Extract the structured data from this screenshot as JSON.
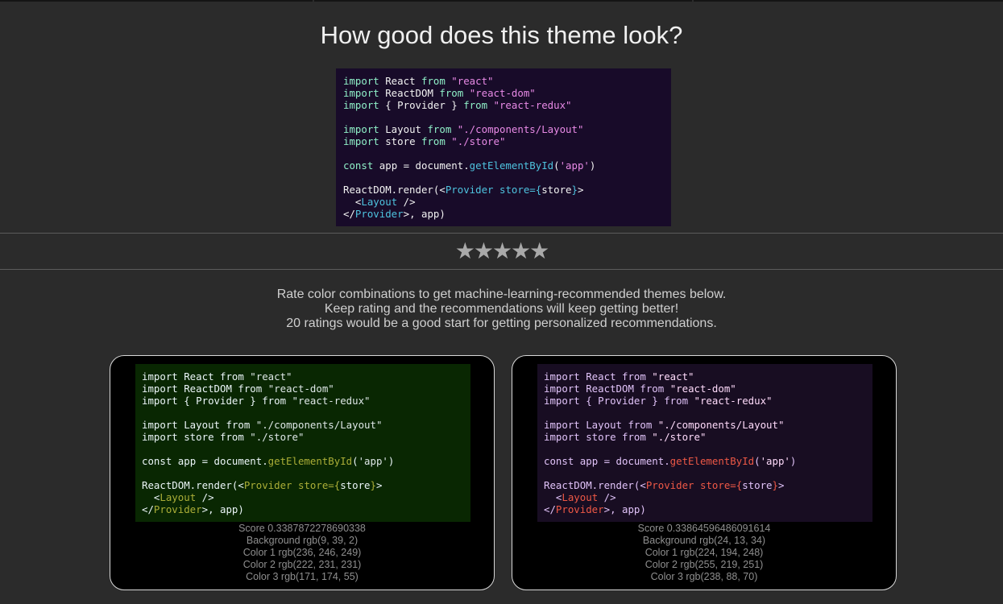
{
  "title": "How good does this theme look?",
  "rating": {
    "stars": [
      "★",
      "★",
      "★",
      "★",
      "★"
    ]
  },
  "intro": [
    "Rate color combinations to get machine-learning-recommended themes below.",
    "Keep rating and the recommendations will keep getting better!",
    "20 ratings would be a good start for getting personalized recommendations."
  ],
  "code_lines": [
    [
      [
        "c1",
        "import"
      ],
      [
        "t",
        " React "
      ],
      [
        "c1",
        "from"
      ],
      [
        "t",
        " "
      ],
      [
        "c2",
        "\"react\""
      ]
    ],
    [
      [
        "c1",
        "import"
      ],
      [
        "t",
        " ReactDOM "
      ],
      [
        "c1",
        "from"
      ],
      [
        "t",
        " "
      ],
      [
        "c2",
        "\"react-dom\""
      ]
    ],
    [
      [
        "c1",
        "import"
      ],
      [
        "t",
        " { Provider } "
      ],
      [
        "c1",
        "from"
      ],
      [
        "t",
        " "
      ],
      [
        "c2",
        "\"react-redux\""
      ]
    ],
    [],
    [
      [
        "c1",
        "import"
      ],
      [
        "t",
        " Layout "
      ],
      [
        "c1",
        "from"
      ],
      [
        "t",
        " "
      ],
      [
        "c2",
        "\"./components/Layout\""
      ]
    ],
    [
      [
        "c1",
        "import"
      ],
      [
        "t",
        " store "
      ],
      [
        "c1",
        "from"
      ],
      [
        "t",
        " "
      ],
      [
        "c2",
        "\"./store\""
      ]
    ],
    [],
    [
      [
        "c1",
        "const"
      ],
      [
        "t",
        " app = document."
      ],
      [
        "c3",
        "getElementById"
      ],
      [
        "t",
        "("
      ],
      [
        "c2",
        "'app'"
      ],
      [
        "t",
        ")"
      ]
    ],
    [],
    [
      [
        "t",
        "ReactDOM.render(<"
      ],
      [
        "c3",
        "Provider"
      ],
      [
        "t",
        " "
      ],
      [
        "c3",
        "store={"
      ],
      [
        "t",
        "store"
      ],
      [
        "c3",
        "}"
      ],
      [
        "t",
        ">"
      ]
    ],
    [
      [
        "t",
        "  <"
      ],
      [
        "c3",
        "Layout"
      ],
      [
        "t",
        " />"
      ]
    ],
    [
      [
        "t",
        "</"
      ],
      [
        "c3",
        "Provider"
      ],
      [
        "t",
        ">, app)"
      ]
    ]
  ],
  "main_theme": {
    "bg": "#180b29",
    "base": "#f2f2f2",
    "c1": "#8ff0c8",
    "c2": "#e88ae6",
    "c3": "#4ec3df"
  },
  "cards": [
    {
      "bg": "rgb(9, 39, 2)",
      "base": "rgb(236, 246, 249)",
      "c1": "rgb(236, 246, 249)",
      "c2": "rgb(222, 231, 231)",
      "c3": "rgb(171, 174, 55)",
      "score": "Score 0.3387872278690338",
      "background": "Background rgb(9, 39, 2)",
      "color1": "Color 1 rgb(236, 246, 249)",
      "color2": "Color 2 rgb(222, 231, 231)",
      "color3": "Color 3 rgb(171, 174, 55)"
    },
    {
      "bg": "rgb(24, 13, 34)",
      "base": "rgb(224, 194, 248)",
      "c1": "rgb(224, 194, 248)",
      "c2": "rgb(255, 219, 251)",
      "c3": "rgb(238, 88, 70)",
      "score": "Score 0.33864596486091614",
      "background": "Background rgb(24, 13, 34)",
      "color1": "Color 1 rgb(224, 194, 248)",
      "color2": "Color 2 rgb(255, 219, 251)",
      "color3": "Color 3 rgb(238, 88, 70)"
    }
  ]
}
